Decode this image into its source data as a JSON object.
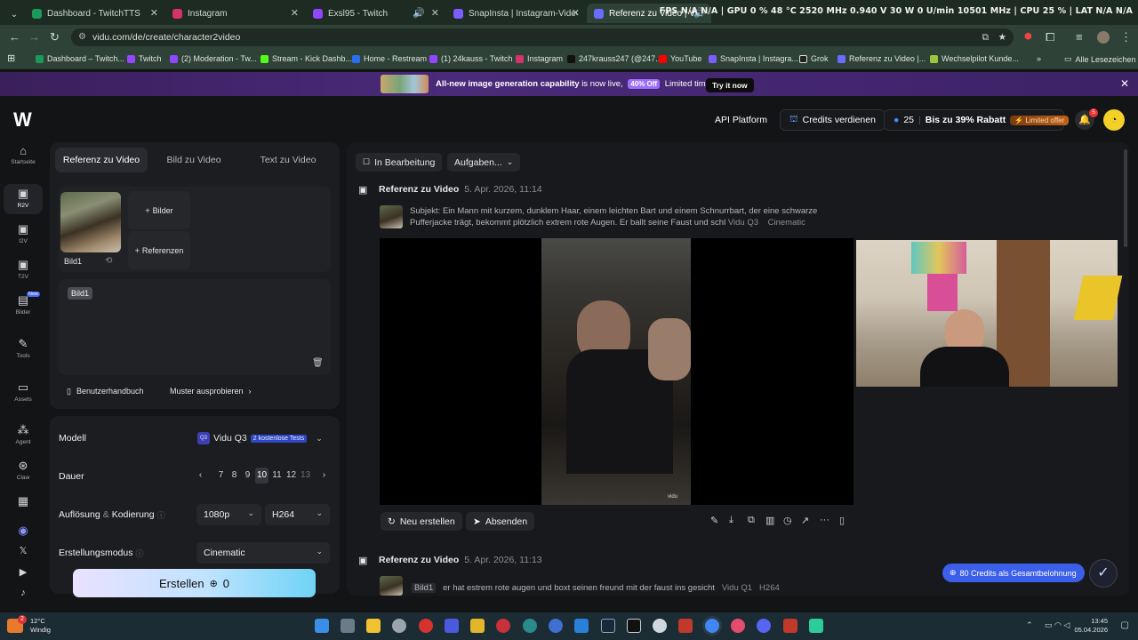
{
  "browser": {
    "tabs": [
      {
        "title": "Dashboard - TwitchTTS",
        "color": "#1b9a5a"
      },
      {
        "title": "Instagram",
        "color": "#d6336c"
      },
      {
        "title": "Exsl95 - Twitch",
        "color": "#9146ff"
      },
      {
        "title": "SnapInsta | Instagram-Videos, F",
        "color": "#7c5cff"
      },
      {
        "title": "Referenz zu Video | Vidu AI",
        "color": "#6a6cff"
      }
    ],
    "hud": "FPS  N/A  N/A  |  GPU  0 %  48 °C  2520 MHz  0.940 V  30 W  0 U/min  10501 MHz  |  CPU  25 %  |  LAT  N/A  N/A",
    "url": "vidu.com/de/create/character2video",
    "bookmarks": [
      "Dashboard – Twitch...",
      "Twitch",
      "(2) Moderation - Tw...",
      "Stream - Kick Dashb...",
      "Home - Restream",
      "(1) 24kauss - Twitch",
      "Instagram",
      "247krauss247 (@247...",
      "YouTube",
      "SnapInsta | Instagra...",
      "Grok",
      "Referenz zu Video |...",
      "Wechselpilot Kunde..."
    ],
    "bookmarks_all": "Alle Lesezeichen"
  },
  "banner": {
    "headline": "All-new image generation capability",
    "tail": "is now live,",
    "pill": "40% Off",
    "limited": "Limited time.",
    "cta": "Try it now"
  },
  "header": {
    "api": "API Platform",
    "credits_earn": "Credits verdienen",
    "credits": "25",
    "discount": "Bis zu 39% Rabatt",
    "offer": "Limited offer",
    "notif_count": "5"
  },
  "rail": [
    {
      "label": "Startseite",
      "icon": "⌂"
    },
    {
      "label": "R2V",
      "icon": "▣"
    },
    {
      "label": "I2V",
      "icon": "▣"
    },
    {
      "label": "T2V",
      "icon": "▣"
    },
    {
      "label": "Bilder",
      "icon": "▤",
      "badge": "New"
    },
    {
      "label": "Tools",
      "icon": "✎"
    },
    {
      "label": "Assets",
      "icon": "▭"
    },
    {
      "label": "Agent",
      "icon": "⁂"
    },
    {
      "label": "Claw",
      "icon": "⊛"
    }
  ],
  "left": {
    "tabs": [
      "Referenz zu Video",
      "Bild zu Video",
      "Text zu Video"
    ],
    "ref_name": "Bild1",
    "add_images": "Bilder",
    "add_refs": "Referenzen",
    "chip": "Bild1",
    "manual": "Benutzerhandbuch",
    "examples": "Muster ausprobieren",
    "model_label": "Modell",
    "model_value": "Vidu Q3",
    "model_badge": "2 kostenlose Tests",
    "duration_label": "Dauer",
    "durations": [
      "7",
      "8",
      "9",
      "10",
      "11",
      "12",
      "13"
    ],
    "duration_selected": "10",
    "resolution_label": "Auflösung",
    "resolution_amp": "&",
    "encoding_label": "Kodierung",
    "resolution_value": "1080p",
    "codec_value": "H264",
    "mode_label": "Erstellungsmodus",
    "mode_value": "Cinematic",
    "create": "Erstellen",
    "create_cost": "0"
  },
  "right": {
    "status_tab": "In Bearbeitung",
    "tasks_tab": "Aufgaben...",
    "job1_title": "Referenz zu Video",
    "job1_date": "5. Apr. 2026, 11:14",
    "job1_prompt": "Subjekt: Ein Mann mit kurzem, dunklem Haar, einem leichten Bart und einem Schnurrbart, der eine schwarze Pufferjacke trägt, bekommt plötzlich extrem rote Augen. Er ballt seine Faust und schl",
    "job1_model": "Vidu Q3",
    "job1_style": "Cinematic",
    "watermark": "vidu",
    "recreate": "Neu erstellen",
    "submit": "Absenden",
    "job2_title": "Referenz zu Video",
    "job2_date": "5. Apr. 2026, 11:13",
    "job2_chip": "Bild1",
    "job2_prompt": "er hat estrem rote augen und boxt seinen freund mit der faust ins gesicht",
    "job2_model": "Vidu Q1",
    "job2_codec": "H264",
    "reward": "80 Credits als Gesamtbelohnung"
  },
  "taskbar": {
    "weather_temp": "12°C",
    "weather_desc": "Windig",
    "weather_badge": "2",
    "time": "13:45",
    "date": "05.04.2026"
  }
}
